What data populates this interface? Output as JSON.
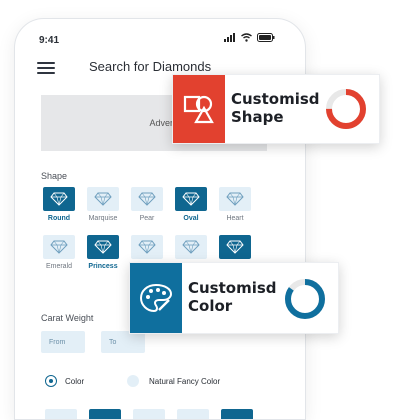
{
  "status_bar": {
    "time": "9:41"
  },
  "header": {
    "title": "Search for Diamonds"
  },
  "ad": {
    "text": "Advertise ban"
  },
  "shape_section": {
    "label": "Shape",
    "row1": [
      {
        "name": "Round",
        "selected": true
      },
      {
        "name": "Marquise",
        "selected": false
      },
      {
        "name": "Pear",
        "selected": false
      },
      {
        "name": "Oval",
        "selected": true
      },
      {
        "name": "Heart",
        "selected": false
      }
    ],
    "row2": [
      {
        "name": "Emerald",
        "selected": false
      },
      {
        "name": "Princess",
        "selected": true
      },
      {
        "name": "",
        "selected": false
      },
      {
        "name": "",
        "selected": false
      },
      {
        "name": "",
        "selected": true
      }
    ]
  },
  "carat": {
    "label": "Carat Weight",
    "from_placeholder": "From",
    "to_placeholder": "To"
  },
  "color_options": {
    "color_label": "Color",
    "fancy_label": "Natural Fancy Color",
    "selected": "Color"
  },
  "cards": {
    "shape": {
      "title": "Customisd\nShape",
      "accent": "#e2412f",
      "progress": 0.75
    },
    "color": {
      "title": "Customisd\nColor",
      "accent": "#0f6f9e",
      "progress": 0.85
    }
  },
  "colors": {
    "brand_blue": "#0f6690",
    "tile_light": "#e3eff7",
    "red": "#e2412f"
  },
  "icons": [
    "menu-icon",
    "signal-icon",
    "wifi-icon",
    "battery-icon",
    "diamond-icon",
    "shapes-icon",
    "palette-icon"
  ]
}
